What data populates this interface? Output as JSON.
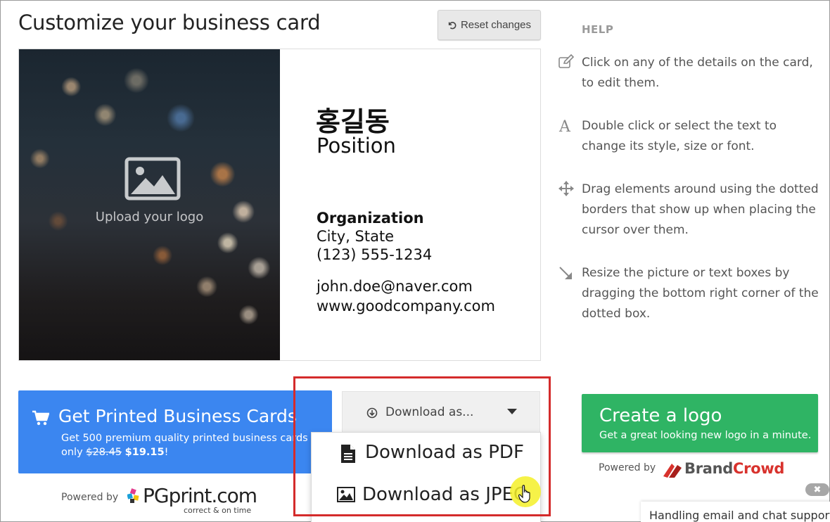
{
  "header": {
    "title": "Customize your business card",
    "reset_label": "Reset changes"
  },
  "card": {
    "upload_label": "Upload your logo",
    "name": "홍길동",
    "position": "Position",
    "organization": "Organization",
    "city_state": "City, State",
    "phone": "(123) 555-1234",
    "email": "john.doe@naver.com",
    "website": "www.goodcompany.com"
  },
  "help": {
    "title": "HELP",
    "items": [
      {
        "icon": "edit-icon",
        "text": "Click on any of the details on the card, to edit them."
      },
      {
        "icon": "font-icon",
        "text": "Double click or select the text to change its style, size or font."
      },
      {
        "icon": "move-icon",
        "text": "Drag elements around using the dotted borders that show up when placing the cursor over them."
      },
      {
        "icon": "resize-icon",
        "text": "Resize the picture or text boxes by dragging the bottom right corner of the dotted box."
      }
    ]
  },
  "print": {
    "title": "Get Printed Business Cards",
    "sub_prefix": "Get 500 premium quality printed business cards for only ",
    "old_price": "$28.45",
    "new_price": "$19.15",
    "sub_suffix": "!",
    "powered_by": "Powered by",
    "brand": "PGprint.com",
    "brand_tagline": "correct & on time"
  },
  "download": {
    "button_label": "Download as...",
    "options": [
      "Download as PDF",
      "Download as JPEG"
    ]
  },
  "logo_cta": {
    "title": "Create a logo",
    "subtitle": "Get a great looking new logo in a minute.",
    "powered_by": "Powered by",
    "brand_a": "Brand",
    "brand_b": "Crowd"
  },
  "chat": {
    "close": "✖",
    "text": "Handling email and chat support"
  },
  "colors": {
    "print_blue": "#3b86f0",
    "logo_green": "#2fb464",
    "highlight_red": "#d42b2b"
  }
}
